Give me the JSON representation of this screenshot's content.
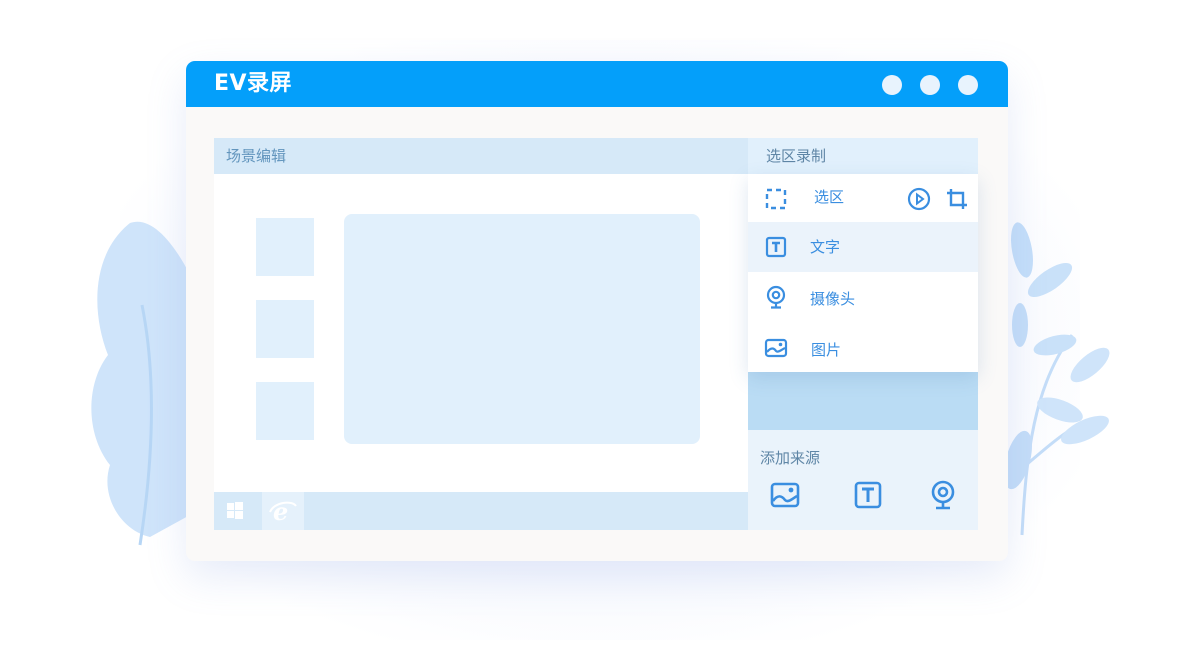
{
  "window": {
    "title": "EV录屏",
    "controls": [
      "minimize-dot",
      "maximize-dot",
      "close-dot"
    ]
  },
  "scene_editor": {
    "title": "场景编辑",
    "taskbar_icons": [
      "windows-icon",
      "ie-icon"
    ]
  },
  "region_record": {
    "title": "选区录制",
    "menu": [
      {
        "label": "选区",
        "icon": "dashed-select-icon",
        "actions": [
          "play-icon",
          "crop-icon"
        ]
      },
      {
        "label": "文字",
        "icon": "text-icon",
        "active": true
      },
      {
        "label": "摄像头",
        "icon": "webcam-icon"
      },
      {
        "label": "图片",
        "icon": "image-icon"
      }
    ]
  },
  "add_source": {
    "title": "添加来源",
    "icons": [
      "image-icon",
      "text-icon",
      "webcam-icon"
    ]
  },
  "colors": {
    "titlebar": "#049ffa",
    "accent": "#3a8ee0",
    "panel_light": "#e1f0fc",
    "panel_mid": "#badcf4"
  }
}
